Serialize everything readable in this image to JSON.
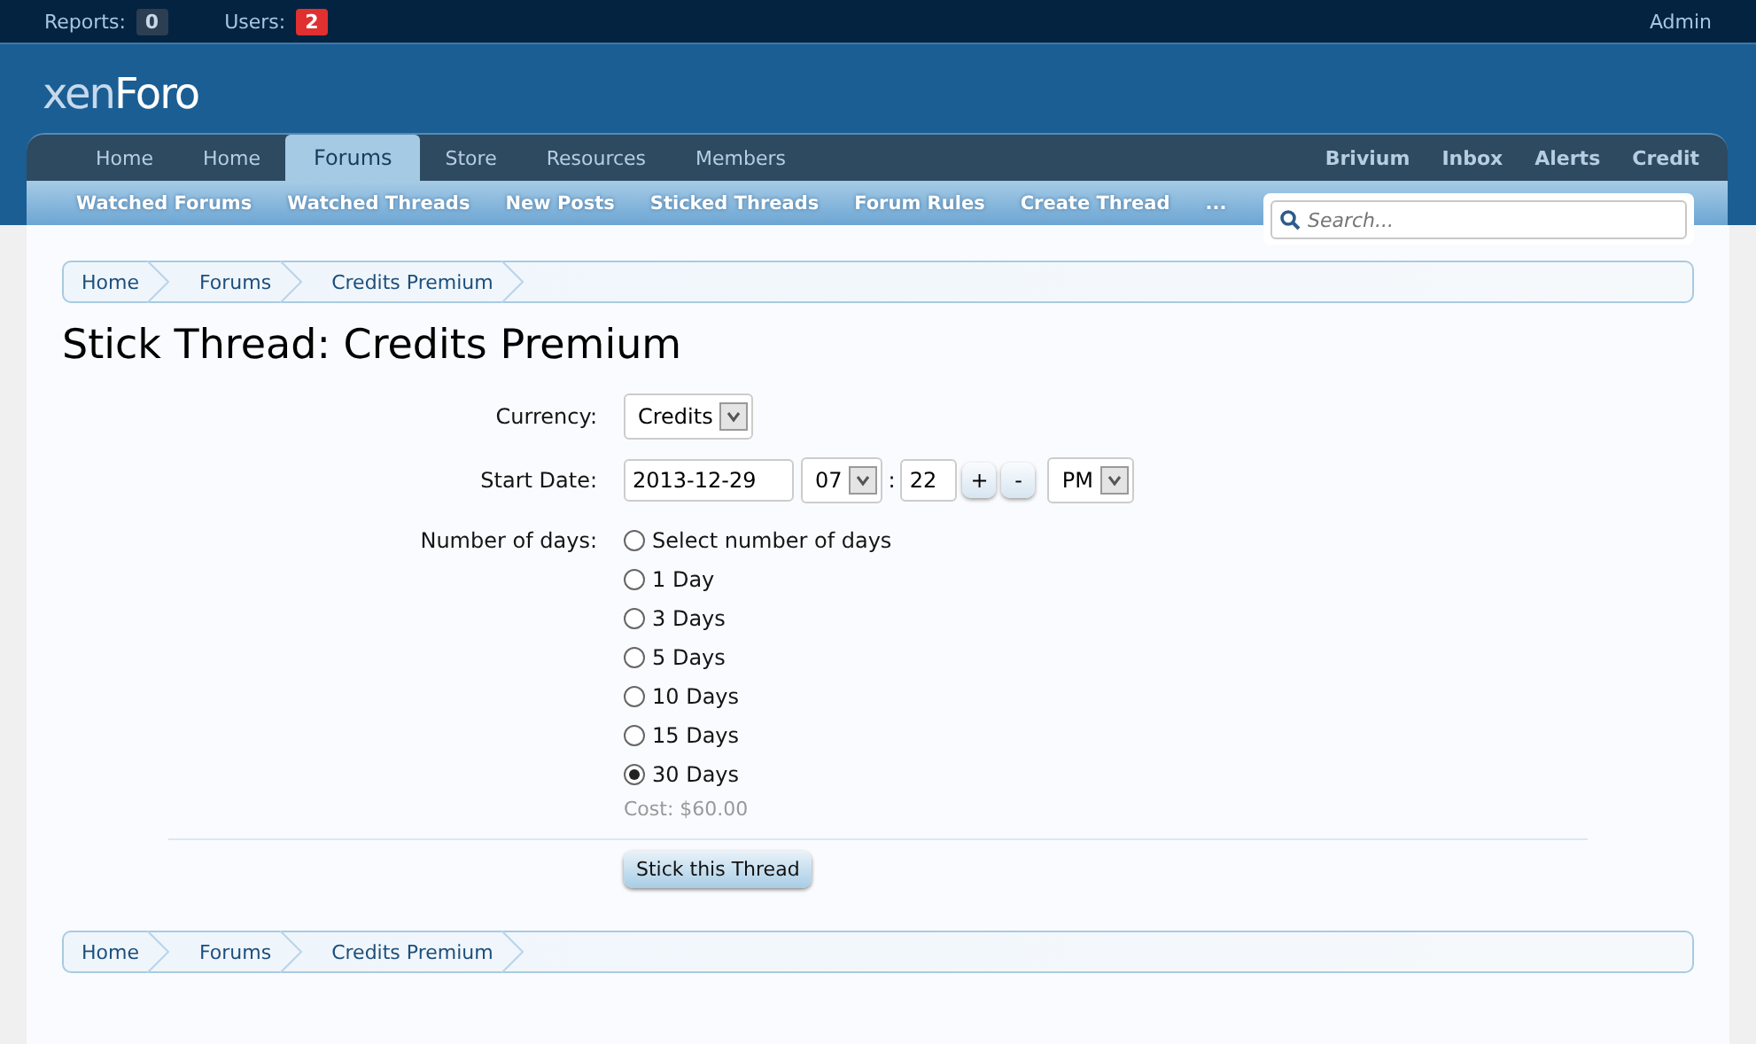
{
  "top_bar": {
    "reports_label": "Reports:",
    "reports_count": "0",
    "users_label": "Users:",
    "users_count": "2",
    "account": "Admin"
  },
  "logo": {
    "light": "xen",
    "bold": "Foro"
  },
  "nav_tabs": [
    {
      "label": "Home",
      "selected": false
    },
    {
      "label": "Home",
      "selected": false
    },
    {
      "label": "Forums",
      "selected": true
    },
    {
      "label": "Store",
      "selected": false
    },
    {
      "label": "Resources",
      "selected": false
    },
    {
      "label": "Members",
      "selected": false
    }
  ],
  "nav_right": [
    "Brivium",
    "Inbox",
    "Alerts",
    "Credit"
  ],
  "sub_nav": [
    "Watched Forums",
    "Watched Threads",
    "New Posts",
    "Sticked Threads",
    "Forum Rules",
    "Create Thread",
    "..."
  ],
  "search": {
    "placeholder": "Search..."
  },
  "breadcrumb_top": [
    "Home",
    "Forums",
    "Credits Premium"
  ],
  "title": "Stick Thread: Credits Premium",
  "form": {
    "currency_label": "Currency:",
    "currency": "Credits",
    "start_date_label": "Start Date:",
    "date": "2013-12-29",
    "hour": "07",
    "separator": ":",
    "minute": "22",
    "plus": "+",
    "minus": "-",
    "ampm": "PM",
    "days_label": "Number of days:",
    "options": [
      {
        "label": "Select number of days",
        "selected": false
      },
      {
        "label": "1 Day",
        "selected": false
      },
      {
        "label": "3 Days",
        "selected": false
      },
      {
        "label": "5 Days",
        "selected": false
      },
      {
        "label": "10 Days",
        "selected": false
      },
      {
        "label": "15 Days",
        "selected": false
      },
      {
        "label": "30 Days",
        "selected": true
      }
    ],
    "cost": "Cost: $60.00",
    "submit": "Stick this Thread"
  },
  "breadcrumb_bottom": [
    "Home",
    "Forums",
    "Credits Premium"
  ]
}
